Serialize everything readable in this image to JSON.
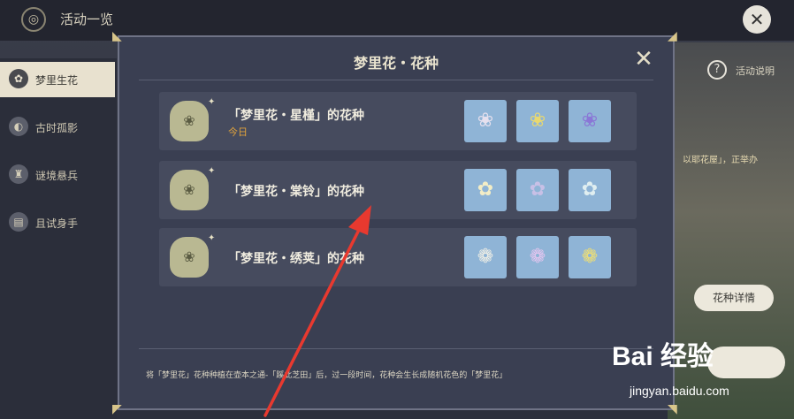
{
  "topbar": {
    "title": "活动一览",
    "close_icon": "close-circle-icon"
  },
  "sidebar": {
    "items": [
      {
        "label": "梦里生花",
        "icon": "flower-pot-icon",
        "active": true
      },
      {
        "label": "古时孤影",
        "icon": "shadow-icon",
        "active": false
      },
      {
        "label": "谜境悬兵",
        "icon": "helmet-icon",
        "active": false
      },
      {
        "label": "且试身手",
        "icon": "cards-icon",
        "active": false
      }
    ]
  },
  "right_panel": {
    "help_label": "活动说明",
    "snippet": "以耶花屋」，正举办",
    "seed_detail_button": "花种详情"
  },
  "modal": {
    "title": "梦里花・花种",
    "close_icon": "close-x-icon",
    "rows": [
      {
        "name": "「梦里花・星槿」的花种",
        "tag": "今日",
        "flower_colors": [
          "#e6e0ee",
          "#e8d870",
          "#8a76d6"
        ]
      },
      {
        "name": "「梦里花・棠铃」的花种",
        "tag": "",
        "flower_colors": [
          "#f3edc6",
          "#c8c0e6",
          "#e0eef0"
        ]
      },
      {
        "name": "「梦里花・绣荚」的花种",
        "tag": "",
        "flower_colors": [
          "#f2f0e6",
          "#e6c6f0",
          "#f2e070"
        ]
      }
    ],
    "footer_note": "将「梦里花」花种种植在壶本之通-「蹊此芝田」后，过一段时间，花种会生长成随机花色的「梦里花」"
  },
  "watermark": {
    "logo": "Bai 经验",
    "url": "jingyan.baidu.com"
  },
  "colors": {
    "accent_red": "#e8392f",
    "tag_orange": "#e0a33c",
    "flower_tile": "#8fb4d6"
  }
}
